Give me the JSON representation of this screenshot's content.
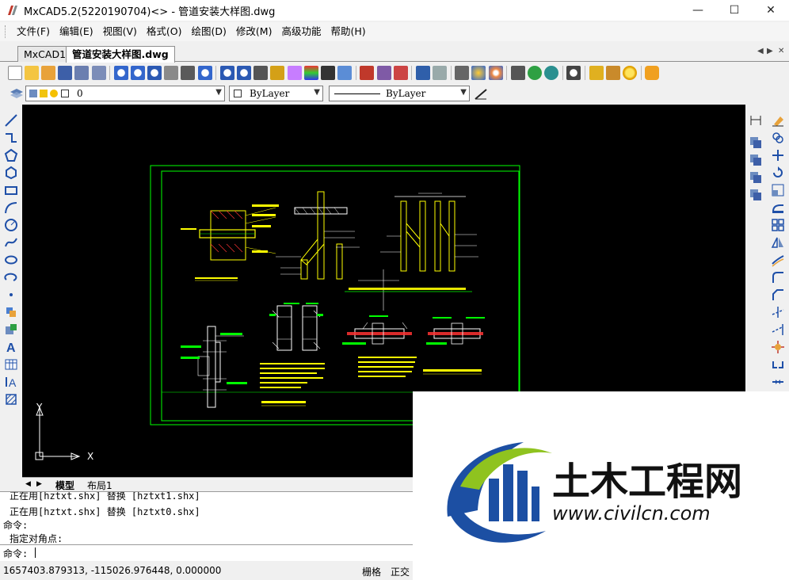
{
  "window": {
    "title": "MxCAD5.2(5220190704)<> - 管道安装大样图.dwg",
    "minimize": "—",
    "maximize": "☐",
    "close": "✕"
  },
  "menu": {
    "items": [
      "文件(F)",
      "编辑(E)",
      "视图(V)",
      "格式(O)",
      "绘图(D)",
      "修改(M)",
      "高级功能",
      "帮助(H)"
    ]
  },
  "tabs": {
    "items": [
      "MxCAD1",
      "管道安装大样图.dwg"
    ],
    "active": "管道安装大样图.dwg",
    "nav_prev": "◀",
    "nav_next": "▶",
    "close": "✕"
  },
  "properties": {
    "layer": "0",
    "color": "ByLayer",
    "linetype": "ByLayer"
  },
  "drawing": {
    "line_color": "#00ff00",
    "text_color": "#ffff00",
    "pipe_color": "#ffffff"
  },
  "ucs": {
    "x_label": "X",
    "y_label": "Y"
  },
  "layout_tabs": {
    "items": [
      "模型",
      "布局1"
    ],
    "active": "模型"
  },
  "command": {
    "history": [
      "正在用[hztxt.shx] 替换 [hztxt1.shx]",
      "正在用[hztxt.shx] 替换 [hztxt0.shx]",
      "命令:",
      "指定对角点:"
    ],
    "prompt": "命令:"
  },
  "status": {
    "coords": "1657403.879313,  -115026.976448,  0.000000",
    "grid": "栅格",
    "ortho": "正交"
  },
  "watermark": {
    "brand": "土木工程网",
    "url": "www.civilcn.com",
    "colors": {
      "blue": "#1c4fa3",
      "green": "#8fc31f",
      "text": "#111111"
    }
  }
}
